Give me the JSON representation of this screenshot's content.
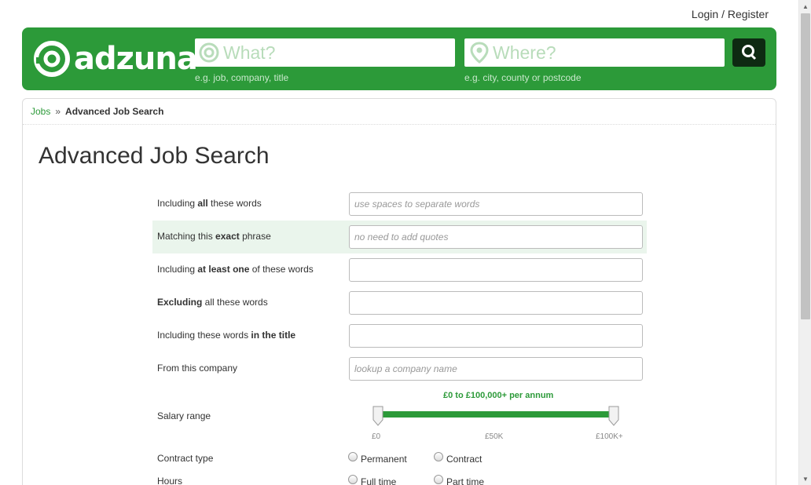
{
  "top": {
    "login": "Login",
    "sep": "/",
    "register": "Register"
  },
  "header": {
    "logo": "adzuna",
    "what_placeholder": "What?",
    "where_placeholder": "Where?",
    "what_hint": "e.g. job, company, title",
    "where_hint": "e.g. city, county or postcode",
    "search_icon": "search-icon",
    "brand_color": "#2c9a39"
  },
  "breadcrumb": {
    "jobs": "Jobs",
    "sep": "»",
    "current": "Advanced Job Search"
  },
  "title": "Advanced Job Search",
  "form": {
    "rows": [
      {
        "pre": "Including ",
        "bold": "all",
        "post": " these words",
        "placeholder": "use spaces to separate words"
      },
      {
        "pre": "Matching this ",
        "bold": "exact",
        "post": " phrase",
        "placeholder": "no need to add quotes"
      },
      {
        "pre": "Including ",
        "bold": "at least one",
        "post": " of these words",
        "placeholder": ""
      },
      {
        "pre": "",
        "bold": "Excluding",
        "post": " all these words",
        "placeholder": ""
      },
      {
        "pre": "Including these words ",
        "bold": "in the title",
        "post": "",
        "placeholder": ""
      },
      {
        "pre": "From this company",
        "bold": "",
        "post": "",
        "placeholder": "lookup a company name"
      }
    ],
    "salary": {
      "label": "Salary range",
      "summary": "£0 to £100,000+ per annum",
      "min": 0,
      "max": 100000,
      "ticks": [
        "£0",
        "£50K",
        "£100K+"
      ]
    },
    "contract": {
      "label": "Contract type",
      "options": [
        "Permanent",
        "Contract"
      ]
    },
    "hours": {
      "label": "Hours",
      "options": [
        "Full time",
        "Part time"
      ]
    }
  }
}
